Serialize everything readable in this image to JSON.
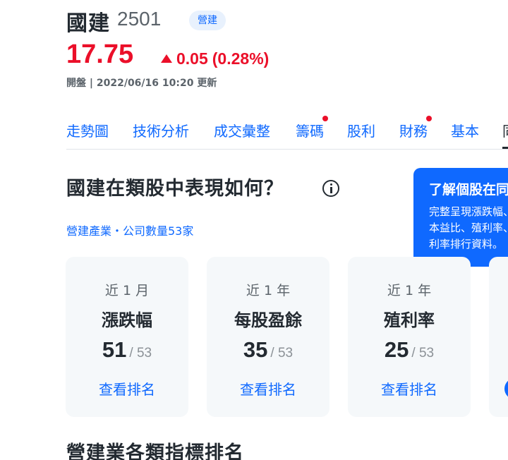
{
  "stock": {
    "name": "國建",
    "code": "2501",
    "tag": "營建",
    "price": "17.75",
    "change": "0.05",
    "change_pct": "(0.28%)",
    "meta": "開盤 | 2022/06/16 10:20 更新"
  },
  "tabs": [
    {
      "label": "走勢圖"
    },
    {
      "label": "技術分析"
    },
    {
      "label": "成交彙整"
    },
    {
      "label": "籌碼"
    },
    {
      "label": "股利"
    },
    {
      "label": "財務"
    },
    {
      "label": "基本"
    },
    {
      "label": "同"
    }
  ],
  "section": {
    "title": "國建在類股中表現如何？",
    "industry_link": "營建產業・公司數量53家"
  },
  "tooltip": {
    "title": "了解個股在同",
    "body": "完整呈現漲跌幅、每股盈餘、本益比、殖利率、本益比、殖利率排行資料。"
  },
  "cards": [
    {
      "period": "近 1 月",
      "metric": "漲跌幅",
      "rank": "51",
      "total": "/ 53",
      "link": "查看排名"
    },
    {
      "period": "近 1 年",
      "metric": "每股盈餘",
      "rank": "35",
      "total": "/ 53",
      "link": "查看排名"
    },
    {
      "period": "近 1 年",
      "metric": "殖利率",
      "rank": "25",
      "total": "/ 53",
      "link": "查看排名"
    }
  ],
  "bottom": {
    "title": "營建業各類指標排名"
  },
  "colors": {
    "up": "#eb0f29",
    "link": "#0f69ff",
    "card_bg": "#f5f8fa"
  }
}
